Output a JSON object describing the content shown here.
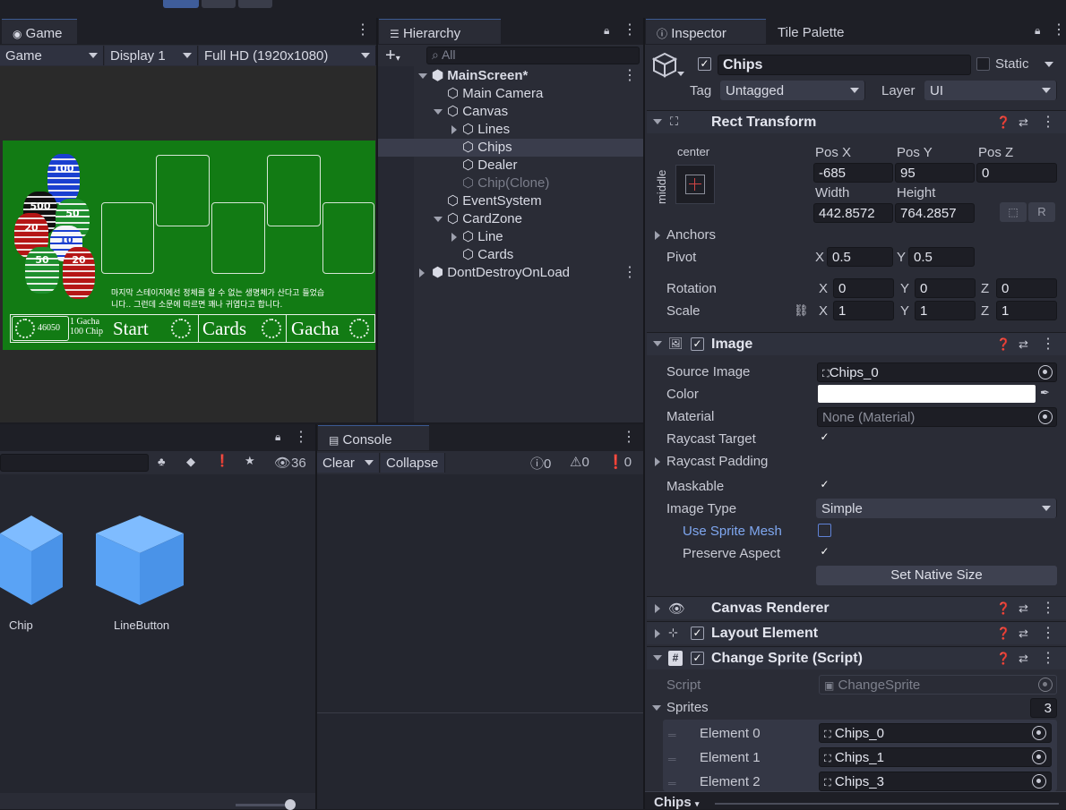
{
  "game": {
    "tab_label": "Game",
    "dd_mode": "Game",
    "dd_display": "Display 1",
    "dd_resolution": "Full HD (1920x1080)",
    "korean_line1": "마지막 스테이지에선 정체를 알 수 없는 생명체가 산다고 들었습",
    "korean_line2": "니다.. 그런데 소문에 따르면 꽤나 귀엽다고 합니다.",
    "chip_count": "46050",
    "gacha_cost_line1": "1 Gacha",
    "gacha_cost_line2": "100 Chip",
    "start_label": "Start",
    "cards_label": "Cards",
    "gacha_label": "Gacha",
    "chip_labels": [
      "100",
      "500",
      "50",
      "20",
      "10",
      "50",
      "20"
    ]
  },
  "hierarchy": {
    "tab_label": "Hierarchy",
    "search_placeholder": "All",
    "items": [
      {
        "label": "MainScreen*"
      },
      {
        "label": "Main Camera"
      },
      {
        "label": "Canvas"
      },
      {
        "label": "Lines"
      },
      {
        "label": "Chips"
      },
      {
        "label": "Dealer"
      },
      {
        "label": "Chip(Clone)"
      },
      {
        "label": "EventSystem"
      },
      {
        "label": "CardZone"
      },
      {
        "label": "Line"
      },
      {
        "label": "Cards"
      },
      {
        "label": "DontDestroyOnLoad"
      }
    ]
  },
  "project": {
    "hidden_count": "36",
    "assets": [
      {
        "label": "Chip"
      },
      {
        "label": "LineButton"
      }
    ]
  },
  "console": {
    "tab_label": "Console",
    "clear_label": "Clear",
    "collapse_label": "Collapse",
    "log_count": "0",
    "warn_count": "0",
    "error_count": "0"
  },
  "inspector": {
    "tab_label": "Inspector",
    "tile_palette_label": "Tile Palette",
    "object_name": "Chips",
    "static_label": "Static",
    "tag_label": "Tag",
    "tag_value": "Untagged",
    "layer_label": "Layer",
    "layer_value": "UI",
    "rect_transform": {
      "title": "Rect Transform",
      "anchor_h": "center",
      "anchor_v": "middle",
      "pos_x_label": "Pos X",
      "pos_x": "-685",
      "pos_y_label": "Pos Y",
      "pos_y": "95",
      "pos_z_label": "Pos Z",
      "pos_z": "0",
      "width_label": "Width",
      "width": "442.8572",
      "height_label": "Height",
      "height": "764.2857",
      "anchors_label": "Anchors",
      "pivot_label": "Pivot",
      "pivot_x": "0.5",
      "pivot_y": "0.5",
      "rotation_label": "Rotation",
      "rot_x": "0",
      "rot_y": "0",
      "rot_z": "0",
      "scale_label": "Scale",
      "scale_x": "1",
      "scale_y": "1",
      "scale_z": "1",
      "x": "X",
      "y": "Y",
      "z": "Z",
      "r_btn": "R"
    },
    "image": {
      "title": "Image",
      "source_image_label": "Source Image",
      "source_image": "Chips_0",
      "color_label": "Color",
      "color_value": "#ffffff",
      "material_label": "Material",
      "material": "None (Material)",
      "raycast_target_label": "Raycast Target",
      "raycast_padding_label": "Raycast Padding",
      "maskable_label": "Maskable",
      "image_type_label": "Image Type",
      "image_type": "Simple",
      "use_sprite_mesh_label": "Use Sprite Mesh",
      "preserve_aspect_label": "Preserve Aspect",
      "set_native_size_label": "Set Native Size"
    },
    "canvas_renderer_title": "Canvas Renderer",
    "layout_element_title": "Layout Element",
    "change_sprite": {
      "title": "Change Sprite (Script)",
      "script_label": "Script",
      "script_value": "ChangeSprite",
      "sprites_label": "Sprites",
      "sprites_count": "3",
      "elements": [
        {
          "label": "Element 0",
          "value": "Chips_0"
        },
        {
          "label": "Element 1",
          "value": "Chips_1"
        },
        {
          "label": "Element 2",
          "value": "Chips_3"
        }
      ]
    },
    "footer_label": "Chips"
  }
}
